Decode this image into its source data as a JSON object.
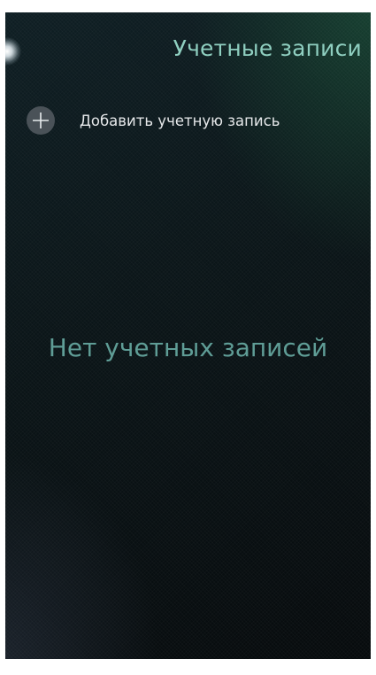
{
  "header": {
    "title": "Учетные записи"
  },
  "actions": {
    "add_account_label": "Добавить учетную запись",
    "add_icon": "plus-icon"
  },
  "empty_state": {
    "text": "Нет учетных записей"
  },
  "colors": {
    "title": "#8fcfc0",
    "empty_text": "#5f9d96",
    "background": "#0b1518"
  }
}
